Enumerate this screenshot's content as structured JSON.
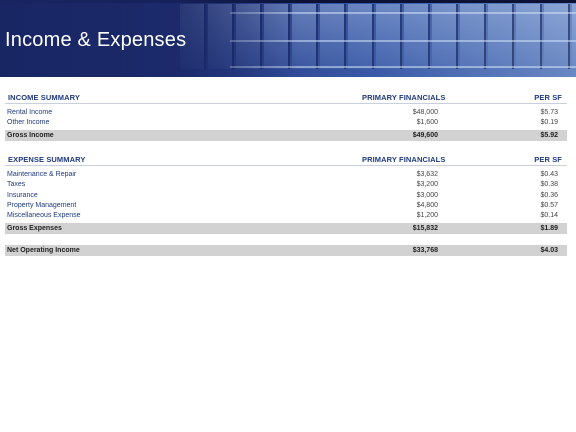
{
  "page": {
    "title": "Income & Expenses"
  },
  "income_summary": {
    "header": "INCOME SUMMARY",
    "col1": "PRIMARY FINANCIALS",
    "col2": "PER SF",
    "rows": [
      {
        "label": "Rental Income",
        "primary": "$48,000",
        "per_sf": "$5.73"
      },
      {
        "label": "Other Income",
        "primary": "$1,600",
        "per_sf": "$0.19"
      }
    ],
    "total": {
      "label": "Gross Income",
      "primary": "$49,600",
      "per_sf": "$5.92"
    }
  },
  "expense_summary": {
    "header": "EXPENSE SUMMARY",
    "col1": "PRIMARY FINANCIALS",
    "col2": "PER SF",
    "rows": [
      {
        "label": "Maintenance & Repair",
        "primary": "$3,632",
        "per_sf": "$0.43"
      },
      {
        "label": "Taxes",
        "primary": "$3,200",
        "per_sf": "$0.38"
      },
      {
        "label": "Insurance",
        "primary": "$3,000",
        "per_sf": "$0.36"
      },
      {
        "label": "Property Management",
        "primary": "$4,800",
        "per_sf": "$0.57"
      },
      {
        "label": "Miscellaneous Expense",
        "primary": "$1,200",
        "per_sf": "$0.14"
      }
    ],
    "total": {
      "label": "Gross Expenses",
      "primary": "$15,832",
      "per_sf": "$1.89"
    }
  },
  "net_operating_income": {
    "label": "Net Operating Income",
    "primary": "$33,768",
    "per_sf": "$4.03"
  }
}
